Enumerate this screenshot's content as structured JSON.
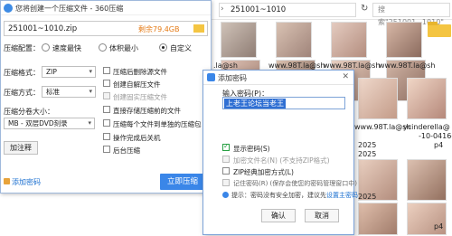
{
  "explorer": {
    "nav": {
      "back": "←",
      "forward": "→",
      "up": "↑"
    },
    "path": "251001~1010",
    "path_prefix": "›",
    "search_placeholder": "搜索\"251001~1010\"",
    "items_row1": [
      {
        "caption": ""
      },
      {
        "caption": ""
      },
      {
        "caption": ""
      },
      {
        "caption": ""
      },
      {
        "caption": ""
      },
      {
        "caption": ""
      }
    ],
    "items_row2": [
      {
        "caption": ".la@sh"
      },
      {
        "caption": "www.98T.la@sh"
      },
      {
        "caption": "www.98T.la@sh"
      },
      {
        "caption": "www.98T.la@sh"
      },
      {
        "caption": "www.98T.la@sh"
      }
    ],
    "items_row3": [
      {
        "caption": ".la@sh"
      },
      {
        "caption": "www.98T.la@sh"
      },
      {
        "caption": "www.98T.la@sh"
      },
      {
        "caption": "www.98T.la@sh"
      },
      {
        "caption": "ycinderella@"
      }
    ],
    "side_captions": [
      "2025",
      "2025",
      "2025",
      "-10-0416-",
      "p4"
    ],
    "row4_captions": [
      "2025",
      "2025",
      "p4"
    ]
  },
  "zip": {
    "title": "您将创建一个压缩文件 - 360压缩",
    "filename": "251001~1010.zip",
    "size_label": "剩余79.4GB",
    "config_label": "压缩配置：",
    "radios": [
      "速度最快",
      "体积最小",
      "自定义"
    ],
    "selected_radio": 2,
    "format_label": "压缩格式：",
    "format_value": "ZIP",
    "method_label": "压缩方式：",
    "method_value": "标准",
    "split_label": "压缩分卷大小：",
    "split_value": "MB - 双层DVD刻录",
    "options": [
      {
        "label": "压缩后删除源文件",
        "state": "off"
      },
      {
        "label": "创建自解压文件",
        "state": "off"
      },
      {
        "label": "创建固实压缩文件",
        "state": "disabled"
      },
      {
        "label": "直接存储压缩前的文件",
        "state": "off"
      },
      {
        "label": "压缩每个文件到单独的压缩包",
        "state": "off"
      },
      {
        "label": "操作完成后关机",
        "state": "off"
      },
      {
        "label": "后台压缩",
        "state": "off"
      }
    ],
    "comment_button": "加注释",
    "add_password_link": "添加密码",
    "start_button": "立即压缩"
  },
  "dialog": {
    "title": "添加密码",
    "close": "✕",
    "input_label": "输入密码(P)：",
    "password_value": "上老王论坛当老王",
    "show_password": "显示密码(S)",
    "encrypt_filename": "加密文件名(N) (不支持ZIP格式)",
    "zip_classic": "ZIP经典加密方式(L)",
    "remember": "记住密码(R) (保存会使您的密码管理窗口中)",
    "warning": "提示：密码没有安全加密，建议先",
    "warning_link": "设置主密码",
    "ok": "确认",
    "cancel": "取消"
  },
  "colors": {
    "accent": "#3a86e8",
    "orange": "#e57a14",
    "green": "#27a043"
  }
}
